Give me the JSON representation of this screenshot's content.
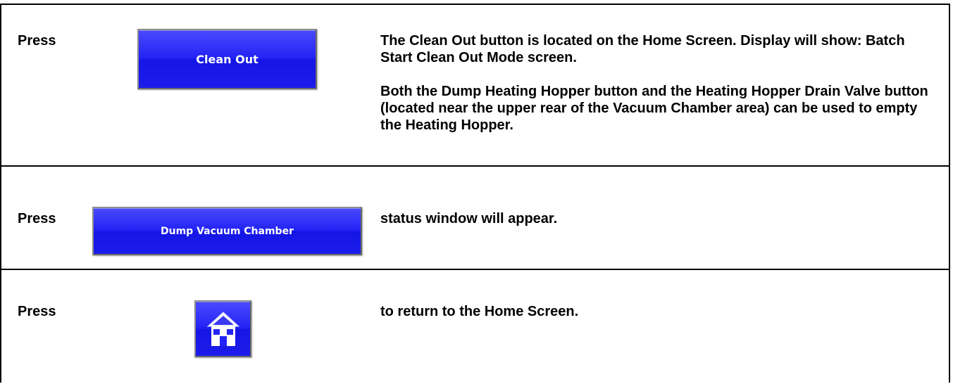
{
  "rows": [
    {
      "press_label": "Press",
      "button_label": "Clean Out",
      "description": [
        "The Clean Out button is located on the Home Screen. Display will show: Batch Start Clean Out Mode screen.",
        "Both the Dump Heating Hopper button and the Heating Hopper Drain Valve button (located near the upper rear of the Vacuum Chamber area) can be used to empty the Heating Hopper."
      ]
    },
    {
      "press_label": "Press",
      "button_label": "Dump Vacuum Chamber",
      "description": [
        "status window will appear."
      ]
    },
    {
      "press_label": "Press",
      "button_icon": "home-icon",
      "description": [
        "to return to the Home Screen."
      ]
    }
  ],
  "colors": {
    "button_blue": "#2323f5",
    "button_text": "#ffffff",
    "border": "#000000"
  }
}
